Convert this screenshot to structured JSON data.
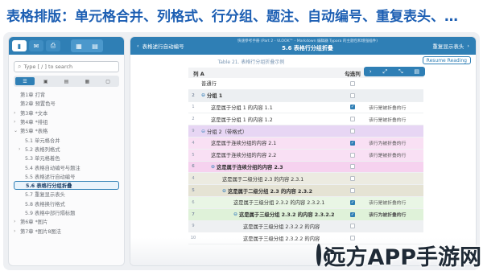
{
  "headline": "表格排版：单元格合并、列格式、行分组、题注、自动编号、重复表头、…",
  "sidebar": {
    "toolbar": {
      "buttons": [
        "sidebar-icon",
        "mail-icon",
        "print-icon"
      ],
      "group_buttons": [
        "layout-icon",
        "split-icon"
      ]
    },
    "search_placeholder": "Type [ / ] to search",
    "tabs": [
      "toc-icon",
      "image-icon",
      "list-icon",
      "grid-icon",
      "settings-icon"
    ],
    "items": [
      {
        "label": "第1章 打背",
        "arrow": "",
        "level": 0
      },
      {
        "label": "第2章 预置色号",
        "arrow": "",
        "level": 0
      },
      {
        "label": "第3章 *文本",
        "arrow": "›",
        "level": 0
      },
      {
        "label": "第4章 *排组",
        "arrow": "›",
        "level": 0
      },
      {
        "label": "第5章 *表格",
        "arrow": "⌄",
        "level": 0
      },
      {
        "label": "5.1 单元格合并",
        "arrow": "",
        "level": 1
      },
      {
        "label": "5.2 表格列格式",
        "arrow": "›",
        "level": 1
      },
      {
        "label": "5.3 单元格着色",
        "arrow": "",
        "level": 1
      },
      {
        "label": "5.4 表格自动编号与题注",
        "arrow": "",
        "level": 1
      },
      {
        "label": "5.5 表格述行自动编号",
        "arrow": "",
        "level": 1
      },
      {
        "label": "5.6 表格行分组折叠",
        "arrow": "",
        "level": 1,
        "current": true
      },
      {
        "label": "5.7 重复显示表头",
        "arrow": "",
        "level": 1
      },
      {
        "label": "5.8 表格换行格式",
        "arrow": "",
        "level": 1
      },
      {
        "label": "5.9 表格中部行隔标题",
        "arrow": "",
        "level": 1
      },
      {
        "label": "第6章 *图片",
        "arrow": "›",
        "level": 0
      },
      {
        "label": "第7章 *图片8图法",
        "arrow": "›",
        "level": 0
      }
    ]
  },
  "topbar": {
    "left_label": "表格述行自动编号",
    "subtitle": "快速参考手册 (Part 2 - VLOOK™ - Markdown 编辑器 Typora 的主题包和增强插件)",
    "title": "5.6 表格行分组折叠",
    "right_label": "重复显示表头"
  },
  "caption": "Table 21. 表格行分组折叠示例",
  "resume_label": "Resume Reading",
  "mini_toolbar": [
    "›",
    "⤢",
    "⤡",
    "▤"
  ],
  "table": {
    "headers": [
      "列 A",
      "勾选列",
      ""
    ],
    "rows": [
      {
        "style": "white",
        "idx": "",
        "indent": 0,
        "ctrl": "",
        "a": "普通行",
        "checked": false,
        "c": ""
      },
      {
        "style": "group1",
        "idx": "2",
        "indent": 0,
        "ctrl": "⊖",
        "a": "分组 1",
        "checked": false,
        "c": ""
      },
      {
        "style": "white",
        "idx": "1",
        "indent": 1,
        "ctrl": "",
        "a": "这是属于分组 1 的内容 1.1",
        "checked": true,
        "c": "该行是被折叠的行"
      },
      {
        "style": "white",
        "idx": "2",
        "indent": 1,
        "ctrl": "",
        "a": "这是属于分组 1 的内容 1.2",
        "checked": false,
        "c": "该行是被折叠的行"
      },
      {
        "style": "group2",
        "idx": "9",
        "indent": 0,
        "ctrl": "⊖",
        "a": "分组 2（带格式）",
        "checked": false,
        "c": ""
      },
      {
        "style": "pink",
        "idx": "4",
        "indent": 1,
        "ctrl": "",
        "a": "这是属于连续分组的内容 2.1",
        "checked": true,
        "c": "该行为被折叠的行"
      },
      {
        "style": "pink",
        "idx": "5",
        "indent": 1,
        "ctrl": "",
        "a": "这是属于连续分组的内容 2.2",
        "checked": false,
        "c": "该行是被折叠的行"
      },
      {
        "style": "pink-head",
        "idx": "6",
        "indent": 1,
        "ctrl": "⊖",
        "a": "这是属于连续分组的内容 2.3",
        "checked": false,
        "c": ""
      },
      {
        "style": "olive",
        "idx": "4",
        "indent": 2,
        "ctrl": "",
        "a": "这是属于二级分组 2.3 的内容 2.3.1",
        "checked": false,
        "c": ""
      },
      {
        "style": "olive-head",
        "idx": "5",
        "indent": 2,
        "ctrl": "⊖",
        "a": "这是属于二级分组 2.3 的内容 2.3.2",
        "checked": false,
        "c": ""
      },
      {
        "style": "green",
        "idx": "6",
        "indent": 3,
        "ctrl": "",
        "a": "这是属于三级分组 2.3.2 的内容 2.3.2.1",
        "checked": true,
        "c": "该行是被折叠的行"
      },
      {
        "style": "green-head",
        "idx": "7",
        "indent": 3,
        "ctrl": "⊖",
        "a": "这是属于三级分组 2.3.2 的内容 2.3.2.2",
        "checked": true,
        "c": "该行为被折叠的行"
      },
      {
        "style": "gray",
        "idx": "9",
        "indent": 4,
        "ctrl": "",
        "a": "这是属于三级分组 2.3.2.2 的内容",
        "checked": false,
        "c": ""
      },
      {
        "style": "white",
        "idx": "10",
        "indent": 4,
        "ctrl": "",
        "a": "这是属于三级分组 2.3.2.2 的内容",
        "checked": false,
        "c": ""
      }
    ]
  },
  "watermark": "远方APP手游网"
}
